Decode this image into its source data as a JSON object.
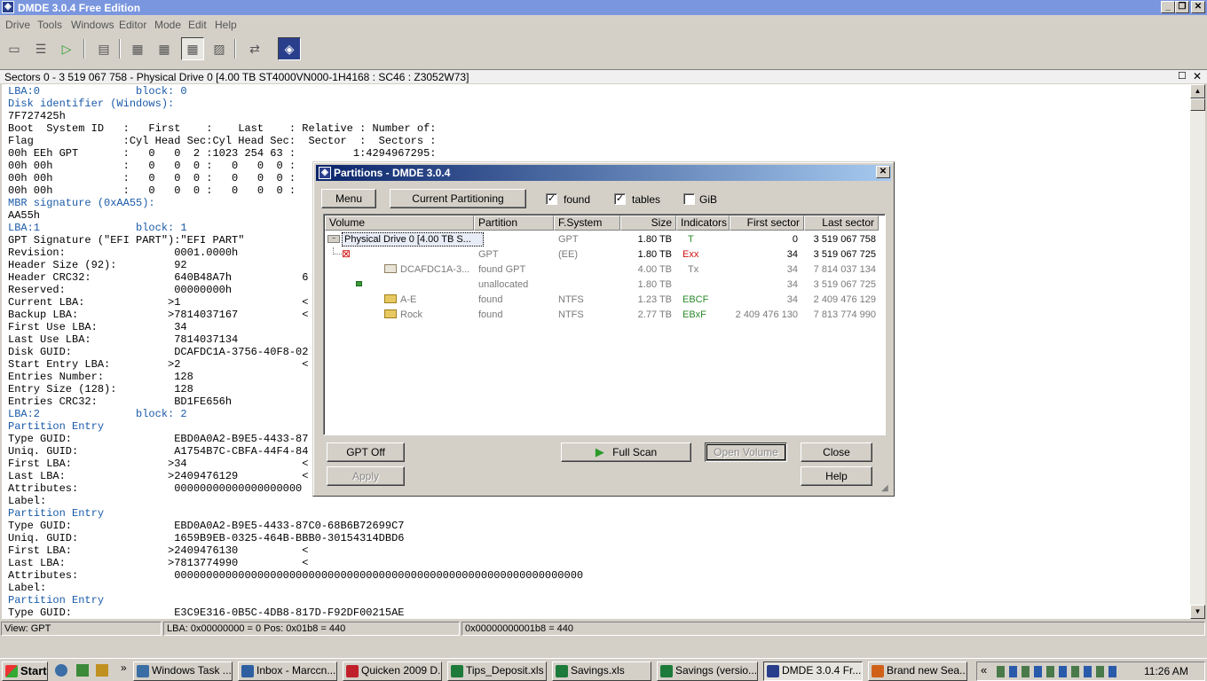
{
  "app": {
    "title": "DMDE 3.0.4 Free Edition",
    "menu": [
      "Drive",
      "Tools",
      "Windows",
      "Editor",
      "Mode",
      "Edit",
      "Help"
    ]
  },
  "sector_bar": {
    "text": "Sectors 0 - 3 519 067 758 - Physical Drive 0 [4.00 TB ST4000VN000-1H4168 : SC46 : Z3052W73]"
  },
  "hex_view": {
    "lines": [
      "LBA:0               block: 0",
      "Disk identifier (Windows):",
      "7F727425h",
      "Boot  System ID   :   First    :    Last    : Relative : Number of:",
      "Flag              :Cyl Head Sec:Cyl Head Sec:  Sector  :  Sectors :",
      "00h EEh GPT       :   0   0  2 :1023 254 63 :         1:4294967295:",
      "00h 00h           :   0   0  0 :   0   0  0 :",
      "00h 00h           :   0   0  0 :   0   0  0 :",
      "00h 00h           :   0   0  0 :   0   0  0 :",
      "MBR signature (0xAA55):",
      "AA55h",
      "LBA:1               block: 1",
      "GPT Signature (\"EFI PART\"):\"EFI PART\"",
      "Revision:                 0001.0000h",
      "Header Size (92):         92",
      "Header CRC32:             640B48A7h           6",
      "Reserved:                 00000000h",
      "Current LBA:             >1                   <",
      "Backup LBA:              >7814037167          <",
      "First Use LBA:            34",
      "Last Use LBA:             7814037134",
      "Disk GUID:                DCAFDC1A-3756-40F8-02",
      "Start Entry LBA:         >2                   <",
      "Entries Number:           128",
      "Entry Size (128):         128",
      "Entries CRC32:            BD1FE656h",
      "LBA:2               block: 2",
      "Partition Entry",
      "Type GUID:                EBD0A0A2-B9E5-4433-87",
      "Uniq. GUID:               A1754B7C-CBFA-44F4-84",
      "First LBA:               >34                  <",
      "Last LBA:                >2409476129          <",
      "Attributes:               00000000000000000000",
      "Label:",
      "Partition Entry",
      "Type GUID:                EBD0A0A2-B9E5-4433-87C0-68B6B72699C7",
      "Uniq. GUID:               1659B9EB-0325-464B-BBB0-30154314DBD6",
      "First LBA:               >2409476130          <",
      "Last LBA:                >7813774990          <",
      "Attributes:               0000000000000000000000000000000000000000000000000000000000000000",
      "Label:",
      "Partition Entry",
      "Type GUID:                E3C9E316-0B5C-4DB8-817D-F92DF00215AE"
    ]
  },
  "status": {
    "view": "View:  GPT",
    "lba": "LBA: 0x00000000 = 0  Pos: 0x01b8 = 440",
    "offset": "0x00000000001b8 = 440"
  },
  "dialog": {
    "title": "Partitions - DMDE 3.0.4",
    "menu_button": "Menu",
    "current_partitioning_button": "Current Partitioning",
    "found_label": "found",
    "found_checked": true,
    "tables_label": "tables",
    "tables_checked": true,
    "gib_label": "GiB",
    "gib_checked": false,
    "columns": [
      "Volume",
      "Partition",
      "F.System",
      "Size",
      "Indicators",
      "First sector",
      "Last sector"
    ],
    "rows": [
      {
        "volume": "Physical Drive 0 [4.00 TB S...",
        "partition": "",
        "fs": "GPT",
        "size": "1.80 TB",
        "ind": "T",
        "first": "0",
        "last": "3 519 067 758"
      },
      {
        "volume": "",
        "partition": "GPT",
        "fs": "(EE)",
        "size": "1.80 TB",
        "ind": "Exx",
        "first": "34",
        "last": "3 519 067 725"
      },
      {
        "volume": "DCAFDC1A-3...",
        "partition": "found GPT",
        "fs": "",
        "size": "4.00 TB",
        "ind": "Tx",
        "first": "34",
        "last": "7 814 037 134"
      },
      {
        "volume": "",
        "partition": "unallocated",
        "fs": "",
        "size": "1.80 TB",
        "ind": "",
        "first": "34",
        "last": "3 519 067 725"
      },
      {
        "volume": "A-E",
        "partition": "found",
        "fs": "NTFS",
        "size": "1.23 TB",
        "ind": "EBCF",
        "first": "34",
        "last": "2 409 476 129"
      },
      {
        "volume": "Rock",
        "partition": "found",
        "fs": "NTFS",
        "size": "2.77 TB",
        "ind": "EBxF",
        "first": "2 409 476 130",
        "last": "7 813 774 990"
      }
    ],
    "gpt_off_button": "GPT Off",
    "apply_button": "Apply",
    "full_scan_button": "Full Scan",
    "open_volume_button": "Open Volume",
    "close_button": "Close",
    "help_button": "Help"
  },
  "taskbar": {
    "start": "Start",
    "tasks": [
      {
        "label": "Windows Task ...",
        "color": "#3a6ea5"
      },
      {
        "label": "Inbox - Marccn...",
        "color": "#2f5fa0"
      },
      {
        "label": "Quicken 2009 D...",
        "color": "#c0202a"
      },
      {
        "label": "Tips_Deposit.xls",
        "color": "#1d7a3a"
      },
      {
        "label": "Savings.xls",
        "color": "#1d7a3a"
      },
      {
        "label": "Savings (versio...",
        "color": "#1d7a3a"
      },
      {
        "label": "DMDE 3.0.4 Fr...",
        "color": "#2a3f8c"
      },
      {
        "label": "Brand new Sea...",
        "color": "#d06018"
      }
    ],
    "clock": "11:26 AM"
  }
}
